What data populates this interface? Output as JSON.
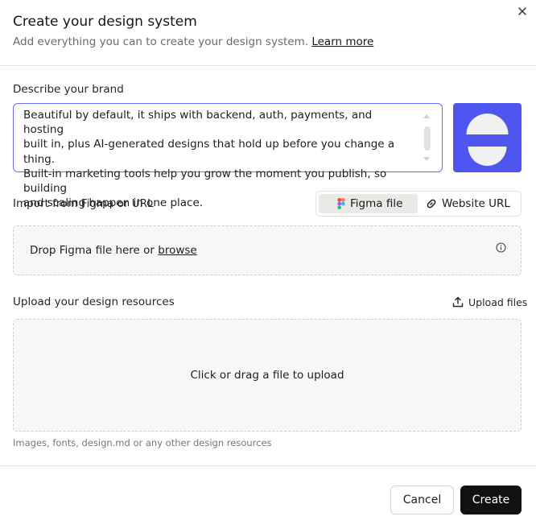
{
  "dialog": {
    "title": "Create your design system",
    "subtitle": "Add everything you can to create your design system.",
    "learn_more": "Learn more"
  },
  "brand": {
    "label": "Describe your brand",
    "description": "Beautiful by default, it ships with backend, auth, payments, and hosting\nbuilt in, plus AI-generated designs that hold up before you change a thing.\nBuilt-in marketing tools help you grow the moment you publish, so building\nand scaling happen in one place.",
    "logo_color": "#4f55f0"
  },
  "import": {
    "label": "Import from Figma or URL",
    "tabs": [
      {
        "label": "Figma file",
        "icon": "figma-icon",
        "active": true
      },
      {
        "label": "Website URL",
        "icon": "link-icon",
        "active": false
      }
    ],
    "drop_text": "Drop Figma file here or",
    "browse": "browse"
  },
  "resources": {
    "label": "Upload your design resources",
    "upload_files": "Upload files",
    "drop_text": "Click or drag a file to upload",
    "hint": "Images, fonts, design.md or any other design resources"
  },
  "footer": {
    "cancel": "Cancel",
    "create": "Create"
  },
  "colors": {
    "primary_button": "#111111",
    "focus_border": "#6b6bff"
  }
}
